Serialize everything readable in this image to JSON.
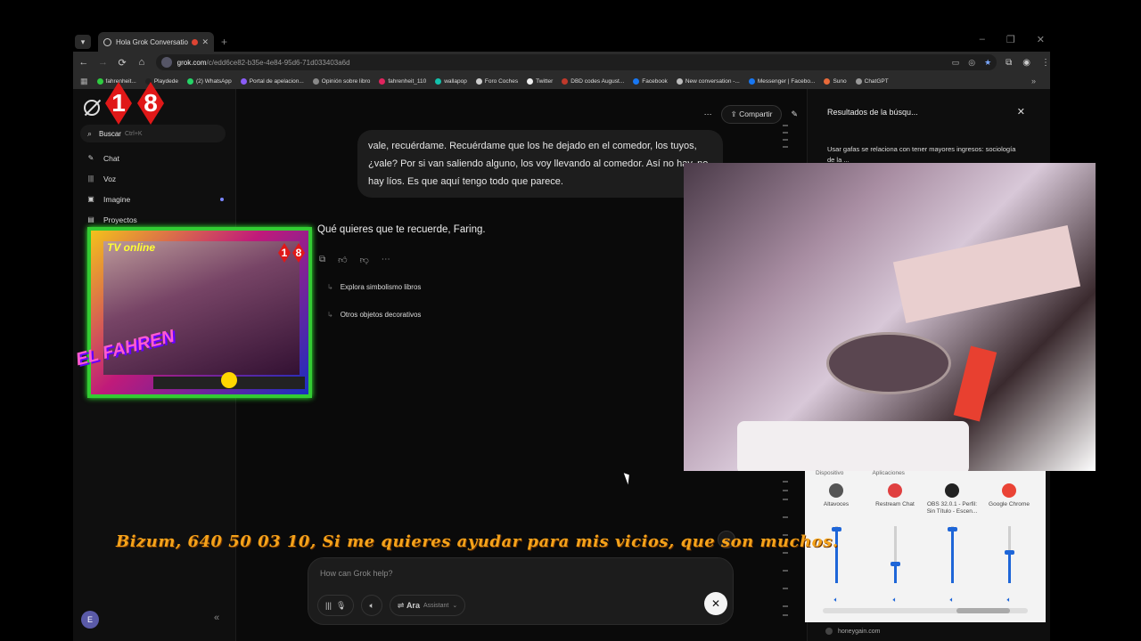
{
  "window": {
    "minimize": "–",
    "restore": "❐",
    "close": "✕"
  },
  "tab": {
    "title": "Hola Grok Conversation - G",
    "close": "✕",
    "new_tab": "+"
  },
  "toolbar": {
    "back": "←",
    "forward": "→",
    "reload": "⟳",
    "home": "⌂",
    "domain": "grok.com",
    "path": "/c/edd6ce82-b35e-4e84-95d6-71d033403a6d"
  },
  "bookmarks": [
    {
      "label": "fahrenheit...",
      "color": "#2ecc40"
    },
    {
      "label": "Playdede",
      "color": "#222222"
    },
    {
      "label": "(2) WhatsApp",
      "color": "#25d366"
    },
    {
      "label": "Portal de apelacion...",
      "color": "#8a5cf6"
    },
    {
      "label": "Opinión sobre libro",
      "color": "#888888"
    },
    {
      "label": "fahrenheit_110",
      "color": "#e0245e"
    },
    {
      "label": "wallapop",
      "color": "#13c1ac"
    },
    {
      "label": "Foro Coches",
      "color": "#cccccc"
    },
    {
      "label": "Twitter",
      "color": "#eeeeee"
    },
    {
      "label": "DBD codes August...",
      "color": "#c0392b"
    },
    {
      "label": "Facebook",
      "color": "#1877f2"
    },
    {
      "label": "New conversation -...",
      "color": "#bbbbbb"
    },
    {
      "label": "Messenger | Facebo...",
      "color": "#1877f2"
    },
    {
      "label": "Suno",
      "color": "#e86a3a"
    },
    {
      "label": "ChatGPT",
      "color": "#999999"
    }
  ],
  "bookmarks_more": "»",
  "sidebar": {
    "search_label": "Buscar",
    "search_shortcut": "Ctrl+K",
    "items": [
      {
        "label": "Chat",
        "icon": "✎"
      },
      {
        "label": "Voz",
        "icon": "|||"
      },
      {
        "label": "Imagine",
        "icon": "▣"
      },
      {
        "label": "Proyectos",
        "icon": "▤"
      }
    ],
    "avatar_initial": "E",
    "collapse": "«"
  },
  "chat": {
    "more": "⋯",
    "share_label": "Compartir",
    "user_message": "vale, recuérdame. Recuérdame que los he dejado en el comedor, los tuyos, ¿vale? Por si van saliendo alguno, los voy llevando al comedor. Así no hay, no hay líos. Es que aquí tengo todo que parece.",
    "assistant_reply": "Qué quieres que te recuerde, Faring.",
    "suggestions": [
      "Explora simbolismo libros",
      "Otros objetos decorativos"
    ],
    "input_placeholder": "How can Grok help?",
    "voice_name": "Ara",
    "voice_role": "Assistant",
    "close": "✕"
  },
  "results": {
    "title": "Resultados de la búsqu...",
    "close": "✕",
    "first": "Usar gafas se relaciona con tener mayores ingresos: sociología de la ...",
    "footer": "honeygain.com"
  },
  "overlay": {
    "age": [
      "1",
      "8"
    ],
    "tv_label": "TV online",
    "fahren": "EL FAHREN",
    "ticker": "Bizum, 640 50 03 10,  Si me quieres ayudar para mis vicios, que son muchos."
  },
  "mixer": {
    "heading_device": "Dispositivo",
    "heading_apps": "Aplicaciones",
    "channels": [
      {
        "name": "Altavoces",
        "color": "#555555",
        "level": 0.95
      },
      {
        "name": "Restream Chat",
        "color": "#e04040",
        "level": 0.35
      },
      {
        "name": "OBS 32.0.1 - Perfil: Sin Título - Escen...",
        "color": "#222222",
        "level": 0.95
      },
      {
        "name": "Google Chrome",
        "color": "#ea4335",
        "level": 0.55
      }
    ]
  }
}
